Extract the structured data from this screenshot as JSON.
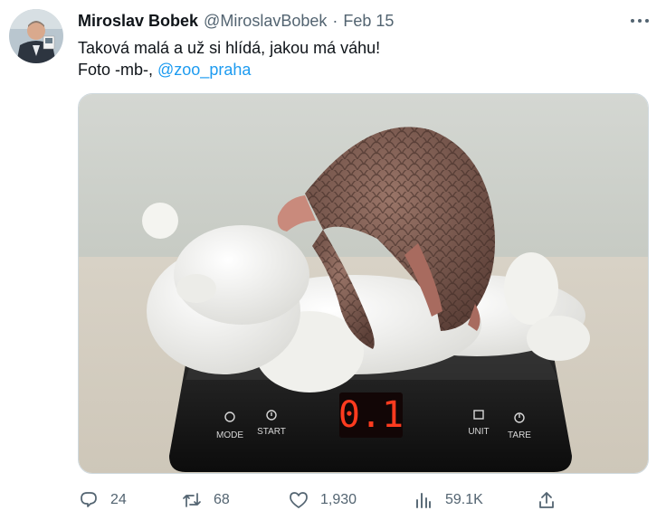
{
  "author": {
    "name": "Miroslav Bobek",
    "handle": "@MiroslavBobek",
    "separator": "·",
    "date": "Feb 15"
  },
  "tweet": {
    "line1": "Taková malá a už si hlídá, jakou má váhu!",
    "line2_prefix": "Foto -mb-, ",
    "mention": "@zoo_praha"
  },
  "media": {
    "scale": {
      "display": "0.1",
      "button_mode": "MODE",
      "button_start": "START",
      "button_unit": "UNIT",
      "button_tare": "TARE"
    }
  },
  "actions": {
    "reply": {
      "icon": "reply-icon",
      "count": "24"
    },
    "retweet": {
      "icon": "retweet-icon",
      "count": "68"
    },
    "like": {
      "icon": "heart-icon",
      "count": "1,930"
    },
    "views": {
      "icon": "views-icon",
      "count": "59.1K"
    },
    "share": {
      "icon": "share-icon"
    }
  },
  "colors": {
    "text_primary": "#0f1419",
    "text_secondary": "#536471",
    "link": "#1d9bf0",
    "display_red": "#ff3b1f"
  }
}
